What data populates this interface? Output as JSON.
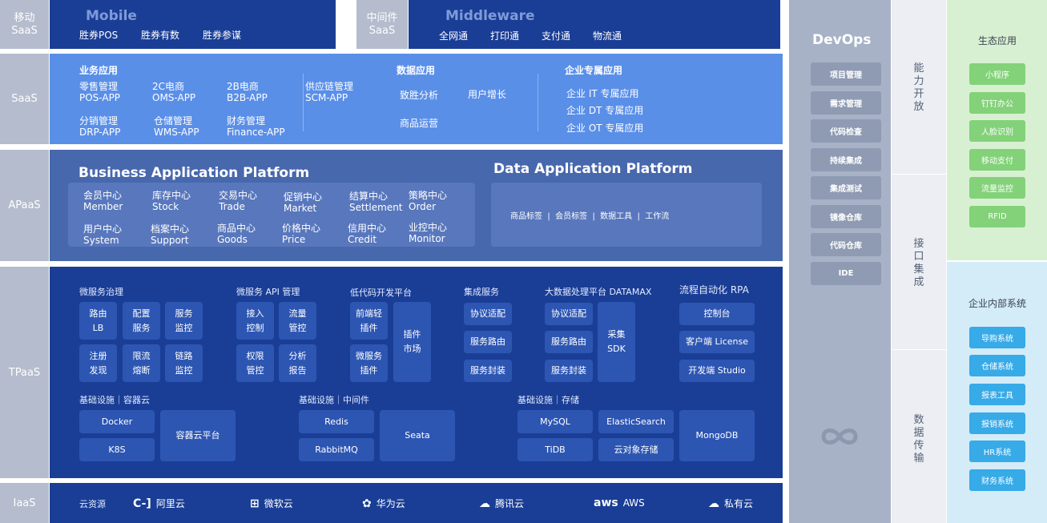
{
  "rows": {
    "mobile": {
      "label": "移动\nSaaS",
      "ghost": "Mobile",
      "items": [
        "胜券POS",
        "胜券有数",
        "胜券参谋"
      ]
    },
    "middleware": {
      "label": "中间件\nSaaS",
      "ghost": "Middleware",
      "items": [
        "全网通",
        "打印通",
        "支付通",
        "物流通"
      ]
    },
    "saas": {
      "label": "SaaS",
      "biz_title": "业务应用",
      "biz_items": [
        {
          "cn": "零售管理",
          "en": "POS-APP"
        },
        {
          "cn": "2C电商",
          "en": "OMS-APP"
        },
        {
          "cn": "2B电商",
          "en": "B2B-APP"
        },
        {
          "cn": "供应链管理",
          "en": "SCM-APP"
        },
        {
          "cn": "分销管理",
          "en": "DRP-APP"
        },
        {
          "cn": "仓储管理",
          "en": "WMS-APP"
        },
        {
          "cn": "财务管理",
          "en": "Finance-APP"
        }
      ],
      "data_title": "数据应用",
      "data_items": [
        "致胜分析",
        "用户增长",
        "商品运营"
      ],
      "ent_title": "企业专属应用",
      "ent_items": [
        "企业 IT 专属应用",
        "企业 DT 专属应用",
        "企业 OT 专属应用"
      ]
    },
    "apaas": {
      "label": "APaaS",
      "bap_title": "Business Application Platform",
      "bap_items": [
        {
          "cn": "会员中心",
          "en": "Member"
        },
        {
          "cn": "库存中心",
          "en": "Stock"
        },
        {
          "cn": "交易中心",
          "en": "Trade"
        },
        {
          "cn": "促销中心",
          "en": "Market"
        },
        {
          "cn": "结算中心",
          "en": "Settlement"
        },
        {
          "cn": "策略中心",
          "en": "Order"
        },
        {
          "cn": "用户中心",
          "en": "System"
        },
        {
          "cn": "档案中心",
          "en": "Support"
        },
        {
          "cn": "商品中心",
          "en": "Goods"
        },
        {
          "cn": "价格中心",
          "en": "Price"
        },
        {
          "cn": "信用中心",
          "en": "Credit"
        },
        {
          "cn": "业控中心",
          "en": "Monitor"
        }
      ],
      "dap_title": "Data Application Platform",
      "dap_items": "商品标签  |  会员标签  |  数据工具  |  工作流"
    },
    "tpaas": {
      "label": "TPaaS",
      "groups": {
        "micro_gov": {
          "title": "微服务治理",
          "chips": [
            "路由\nLB",
            "配置\n服务",
            "服务\n监控",
            "注册\n发现",
            "限流\n熔断",
            "链路\n监控"
          ]
        },
        "micro_api": {
          "title": "微服务 API 管理",
          "chips": [
            "接入\n控制",
            "流量\n管控",
            "权限\n管控",
            "分析\n报告"
          ]
        },
        "lowcode": {
          "title": "低代码开发平台",
          "chips": [
            "前端轻\n插件",
            "微服务\n插件",
            "插件\n市场"
          ]
        },
        "integration": {
          "title": "集成服务",
          "chips": [
            "协议适配",
            "服务路由",
            "服务封装"
          ]
        },
        "bigdata": {
          "title": "大数据处理平台 DATAMAX",
          "chips": [
            "协议适配",
            "服务路由",
            "服务封装",
            "采集\nSDK"
          ]
        },
        "rpa": {
          "title": "流程自动化 RPA",
          "chips": [
            "控制台",
            "客户端 License",
            "开发端 Studio"
          ]
        },
        "infra_container": {
          "title": "基础设施｜容器云",
          "chips": [
            "Docker",
            "K8S",
            "容器云平台"
          ]
        },
        "infra_middleware": {
          "title": "基础设施｜中间件",
          "chips": [
            "Redis",
            "RabbitMQ",
            "Seata"
          ]
        },
        "infra_storage": {
          "title": "基础设施｜存储",
          "chips": [
            "MySQL",
            "ElasticSearch",
            "TiDB",
            "云对象存储",
            "MongoDB"
          ]
        }
      }
    },
    "iaas": {
      "label": "IaaS",
      "prefix": "云资源",
      "clouds": [
        {
          "icon": "C-]",
          "name": "阿里云"
        },
        {
          "icon": "⊞",
          "name": "微软云"
        },
        {
          "icon": "✿",
          "name": "华为云"
        },
        {
          "icon": "☁",
          "name": "腾讯云"
        },
        {
          "icon": "aws",
          "name": "AWS"
        },
        {
          "icon": "☁",
          "name": "私有云"
        }
      ]
    }
  },
  "devops": {
    "title": "DevOps",
    "items": [
      "项目管理",
      "需求管理",
      "代码检查",
      "持续集成",
      "集成测试",
      "镜像仓库",
      "代码仓库",
      "IDE"
    ]
  },
  "mid_column": {
    "groups": [
      "能力开放",
      "接口集成",
      "数据传输"
    ]
  },
  "eco": {
    "title": "生态应用",
    "items": [
      "小程序",
      "钉钉办公",
      "人脸识别",
      "移动支付",
      "流量监控",
      "RFID"
    ]
  },
  "enterprise": {
    "title": "企业内部系统",
    "items": [
      "导购系统",
      "仓储系统",
      "报表工具",
      "报销系统",
      "HR系统",
      "财务系统"
    ]
  }
}
